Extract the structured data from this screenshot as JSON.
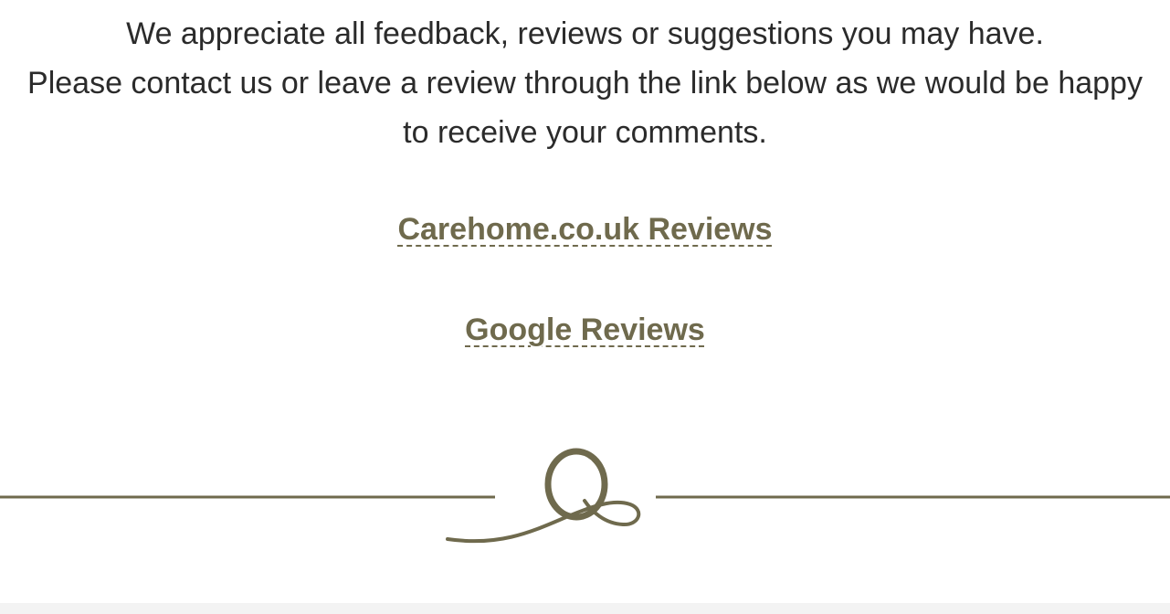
{
  "intro": {
    "line1": "We appreciate all feedback, reviews or suggestions you may have.",
    "line2": "Please contact us or leave a review through the link below as we would be happy",
    "line3": "to receive your comments."
  },
  "links": {
    "carehome": "Carehome.co.uk Reviews",
    "google": "Google Reviews"
  },
  "colors": {
    "accent": "#6f6a4d",
    "text": "#2b2b2b",
    "footer": "#f3f3f3"
  },
  "icons": {
    "divider_logo": "q-monogram-icon"
  }
}
